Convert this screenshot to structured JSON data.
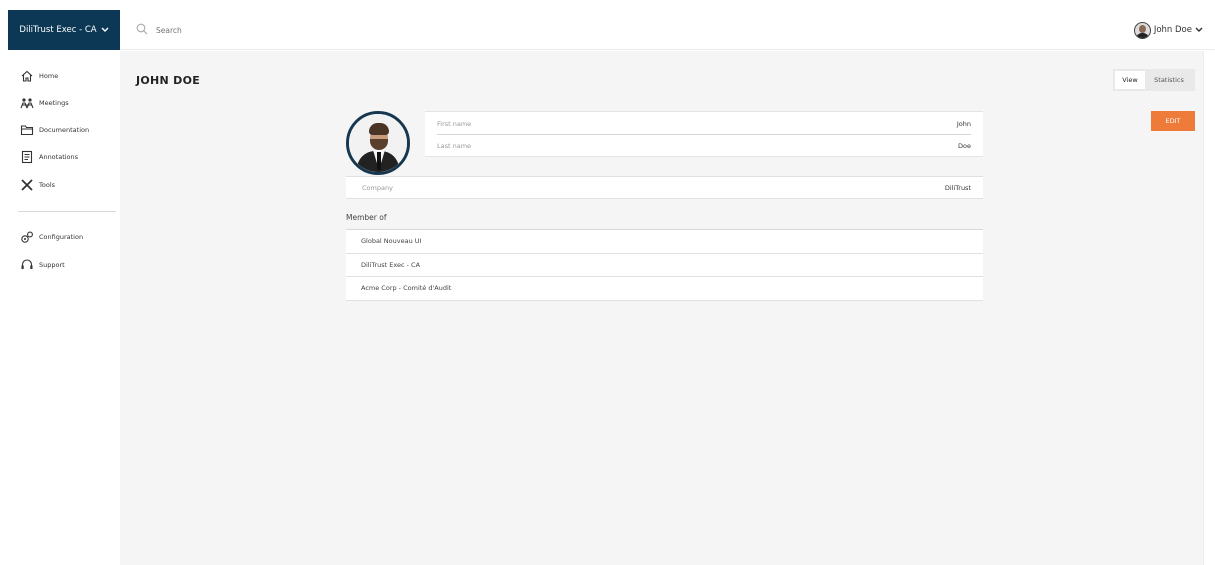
{
  "org_switcher": {
    "label": "DiliTrust Exec - CA",
    "icon": "chevron-down-icon"
  },
  "search": {
    "placeholder": "Search",
    "icon": "search-icon"
  },
  "user_menu": {
    "name": "John Doe",
    "icon": "chevron-down-icon"
  },
  "sidebar": {
    "items": [
      {
        "label": "Home",
        "icon": "home-icon"
      },
      {
        "label": "Meetings",
        "icon": "meetings-icon"
      },
      {
        "label": "Documentation",
        "icon": "folder-icon"
      },
      {
        "label": "Annotations",
        "icon": "annotations-icon"
      },
      {
        "label": "Tools",
        "icon": "tools-icon"
      }
    ],
    "bottom_items": [
      {
        "label": "Configuration",
        "icon": "configuration-icon"
      },
      {
        "label": "Support",
        "icon": "support-icon"
      }
    ]
  },
  "page": {
    "title": "JOHN DOE",
    "view_toggle": {
      "view": "View",
      "statistics": "Statistics",
      "selected": "View"
    },
    "edit_label": "EDIT",
    "profile": {
      "first_name_label": "First name",
      "first_name": "John",
      "last_name_label": "Last name",
      "last_name": "Doe",
      "company_label": "Company",
      "company": "DiliTrust"
    },
    "member_of_title": "Member of",
    "member_of": [
      "Global Nouveau UI",
      "DiliTrust Exec - CA",
      "Acme Corp - Comité d'Audit"
    ]
  },
  "colors": {
    "brand_dark": "#0c3856",
    "accent": "#ee7b3a",
    "background": "#f5f5f5"
  }
}
